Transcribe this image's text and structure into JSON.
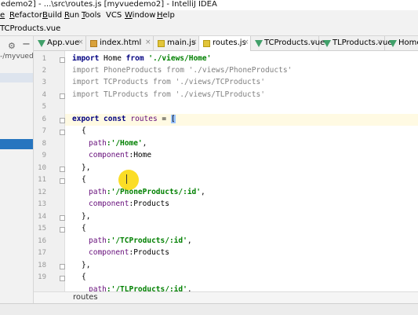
{
  "window": {
    "title": "edemo2] - ...\\src\\routes.js [myvuedemo2] - IntelliJ IDEA"
  },
  "menu": {
    "items": [
      {
        "underline": "e",
        "rest": ""
      },
      {
        "underline": "R",
        "rest": "efactor"
      },
      {
        "underline": "B",
        "rest": "uild"
      },
      {
        "underline": "R",
        "rest": "un"
      },
      {
        "underline": "T",
        "rest": "ools"
      },
      {
        "underline": "",
        "rest": "VCS"
      },
      {
        "underline": "W",
        "rest": "indow"
      },
      {
        "underline": "H",
        "rest": "elp"
      }
    ]
  },
  "breadcrumb": {
    "label": "TCProducts.vue"
  },
  "project_panel": {
    "path": "-/myvuede"
  },
  "tabs": [
    {
      "label": "App.vue",
      "icon": "vue-icon",
      "active": false
    },
    {
      "label": "index.html",
      "icon": "html-icon",
      "active": false
    },
    {
      "label": "main.js",
      "icon": "js-icon",
      "active": false
    },
    {
      "label": "routes.js",
      "icon": "js-icon",
      "active": true
    },
    {
      "label": "TCProducts.vue",
      "icon": "vue-icon",
      "active": false
    },
    {
      "label": "TLProducts.vue",
      "icon": "vue-icon",
      "active": false
    },
    {
      "label": "Home.",
      "icon": "vue-icon",
      "active": false
    }
  ],
  "tab_close_glyph": "×",
  "line_numbers": [
    "1",
    "2",
    "3",
    "4",
    "5",
    "6",
    "7",
    "8",
    "9",
    "10",
    "11",
    "12",
    "13",
    "14",
    "15",
    "16",
    "17",
    "18",
    "19"
  ],
  "code": {
    "l1": {
      "kw": "import",
      "name": " Home ",
      "kw2": "from",
      "str": " './views/Home'"
    },
    "l2": {
      "text": "import PhoneProducts from './views/PhoneProducts'"
    },
    "l3": {
      "text": "import TCProducts from './views/TCProducts'"
    },
    "l4": {
      "text": "import TLProducts from './views/TLProducts'"
    },
    "l6": {
      "kw": "export const",
      "name": " routes ",
      "op": "= ",
      "bracket": "["
    },
    "l7": "{",
    "l8": {
      "prop": "path",
      "str": ":'/Home'",
      "tail": ","
    },
    "l9": {
      "prop": "component",
      "val": ":Home"
    },
    "l10": "},",
    "l11": "{",
    "l12": {
      "prop": "path",
      "str": ":'/PhoneProducts/:id'",
      "tail": ","
    },
    "l13": {
      "prop": "component",
      "val": ":Products"
    },
    "l14": "},",
    "l15": "{",
    "l16": {
      "prop": "path",
      "str": ":'/TCProducts/:id'",
      "tail": ","
    },
    "l17": {
      "prop": "component",
      "val": ":Products"
    },
    "l18": "},",
    "l19": "{",
    "l20": {
      "prop": "path",
      "str": ":'/TLProducts/:id'",
      "tail": ","
    }
  },
  "status": {
    "breadcrumb": "routes"
  },
  "colors": {
    "keyword": "#000080",
    "string": "#008000",
    "property": "#660e7a",
    "current_line": "#fffae3",
    "selection": "#2675bf",
    "cursor_highlight": "#fad700"
  }
}
